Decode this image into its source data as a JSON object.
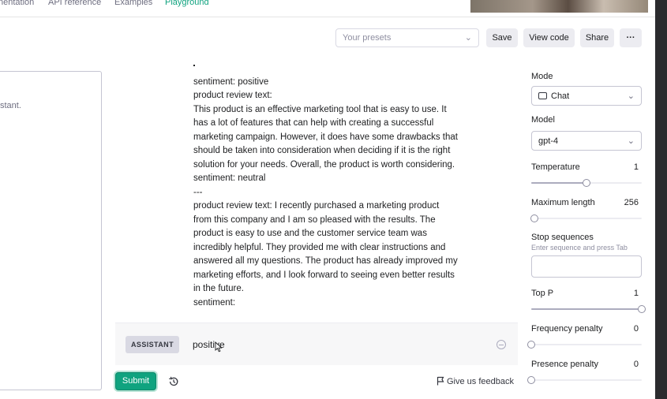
{
  "nav": {
    "items": [
      {
        "label": "nentation",
        "active": false
      },
      {
        "label": "API reference",
        "active": false
      },
      {
        "label": "Examples",
        "active": false
      },
      {
        "label": "Playground",
        "active": true
      }
    ]
  },
  "toolbar": {
    "presets_placeholder": "Your presets",
    "save_label": "Save",
    "view_code_label": "View code",
    "share_label": "Share",
    "more_label": "···"
  },
  "system": {
    "text": "stant."
  },
  "chat": {
    "lines": [
      "sentiment: positive",
      "product review text:",
      "This product is an effective marketing tool that is easy to use. It",
      "has a lot of features that can help with creating a successful",
      "marketing campaign. However, it does have some drawbacks that",
      "should be taken into consideration when deciding if it is the right",
      "solution for your needs. Overall, the product is worth considering.",
      "sentiment: neutral",
      "---",
      "product review text:  I recently purchased a marketing product",
      "from this company and I am so pleased with the results. The",
      "product is easy to use and the customer service team was",
      "incredibly helpful. They provided me with clear instructions and",
      "answered all my questions. The product has already improved my",
      "marketing efforts, and I look forward to seeing even better results",
      "in the future.",
      "sentiment:"
    ]
  },
  "assistant": {
    "role_label": "ASSISTANT",
    "text": "positive"
  },
  "footer": {
    "submit_label": "Submit",
    "feedback_label": "Give us feedback"
  },
  "settings": {
    "mode": {
      "label": "Mode",
      "value": "Chat"
    },
    "model": {
      "label": "Model",
      "value": "gpt-4"
    },
    "temperature": {
      "label": "Temperature",
      "value": "1",
      "fraction": 0.5
    },
    "max_length": {
      "label": "Maximum length",
      "value": "256",
      "fraction": 0.03
    },
    "stop_sequences": {
      "label": "Stop sequences",
      "hint": "Enter sequence and press Tab"
    },
    "top_p": {
      "label": "Top P",
      "value": "1",
      "fraction": 1.0
    },
    "frequency_penalty": {
      "label": "Frequency penalty",
      "value": "0",
      "fraction": 0.0
    },
    "presence_penalty": {
      "label": "Presence penalty",
      "value": "0",
      "fraction": 0.0
    }
  },
  "colors": {
    "accent": "#10a37f",
    "text": "#202123",
    "muted": "#6e6e80"
  }
}
